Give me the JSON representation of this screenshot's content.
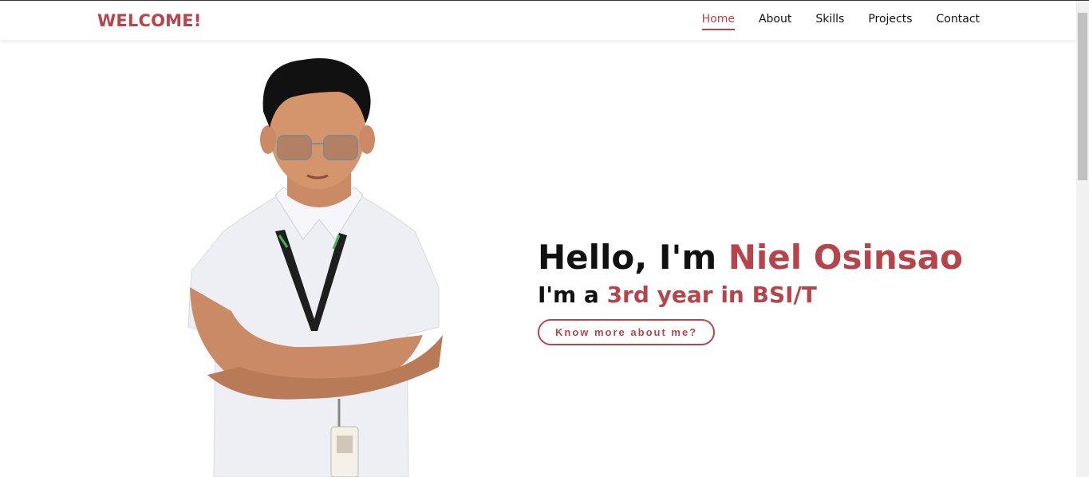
{
  "header": {
    "brand": "WELCOME!",
    "nav": [
      {
        "label": "Home",
        "active": true
      },
      {
        "label": "About"
      },
      {
        "label": "Skills"
      },
      {
        "label": "Projects"
      },
      {
        "label": "Contact"
      }
    ]
  },
  "hero": {
    "greeting_prefix": "Hello, I'm ",
    "name": "Niel Osinsao",
    "subline_prefix": "I'm a ",
    "subline_accent": "3rd year in BSI/T",
    "cta_label": "Know more about me?"
  },
  "colors": {
    "accent": "#b5454b",
    "text": "#111111",
    "background": "#ffffff"
  }
}
